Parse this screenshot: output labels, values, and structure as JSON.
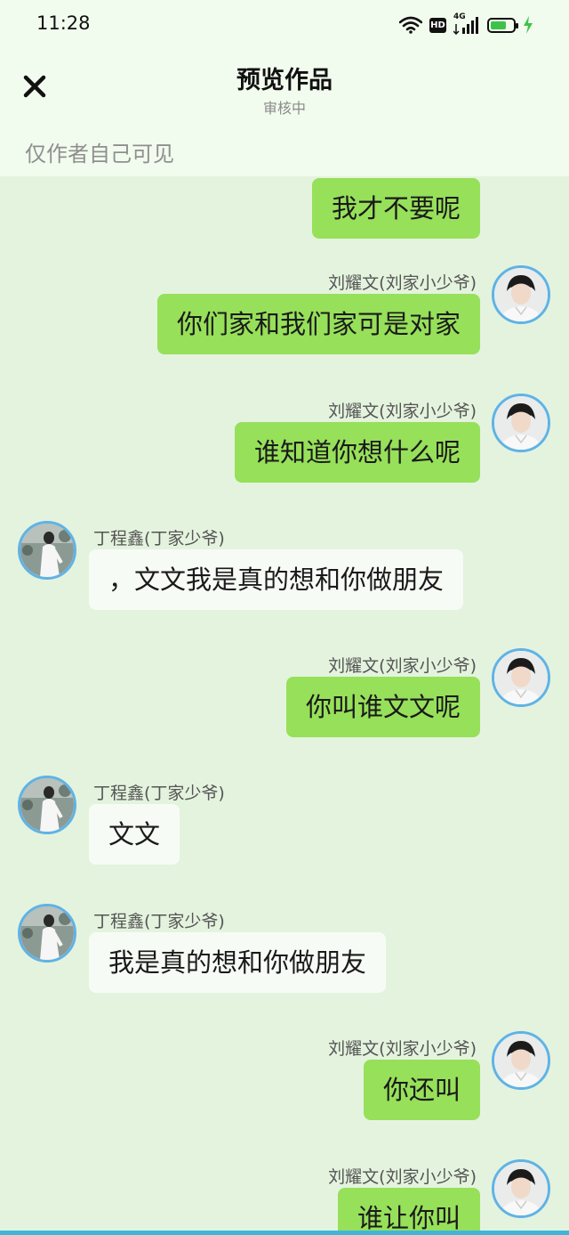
{
  "status_bar": {
    "time": "11:28",
    "hd_label": "HD",
    "network_label": "4G",
    "battery_percent": 70
  },
  "header": {
    "title": "预览作品",
    "subtitle": "审核中",
    "visibility_note": "仅作者自己可见"
  },
  "colors": {
    "page_background": "#e4f3de",
    "header_background": "#f2fcee",
    "right_bubble": "#97e05a",
    "left_bubble": "#f7fbf5",
    "avatar_ring": "#5fb3e6"
  },
  "messages": [
    {
      "side": "right",
      "sender": "",
      "text": "我才不要呢"
    },
    {
      "side": "right",
      "sender": "刘耀文(刘家小少爷)",
      "text": "你们家和我们家可是对家"
    },
    {
      "side": "right",
      "sender": "刘耀文(刘家小少爷)",
      "text": "谁知道你想什么呢"
    },
    {
      "side": "left",
      "sender": "丁程鑫(丁家少爷)",
      "text": "，文文我是真的想和你做朋友"
    },
    {
      "side": "right",
      "sender": "刘耀文(刘家小少爷)",
      "text": "你叫谁文文呢"
    },
    {
      "side": "left",
      "sender": "丁程鑫(丁家少爷)",
      "text": "文文"
    },
    {
      "side": "left",
      "sender": "丁程鑫(丁家少爷)",
      "text": "我是真的想和你做朋友"
    },
    {
      "side": "right",
      "sender": "刘耀文(刘家小少爷)",
      "text": "你还叫"
    },
    {
      "side": "right",
      "sender": "刘耀文(刘家小少爷)",
      "text": "谁让你叫"
    }
  ]
}
